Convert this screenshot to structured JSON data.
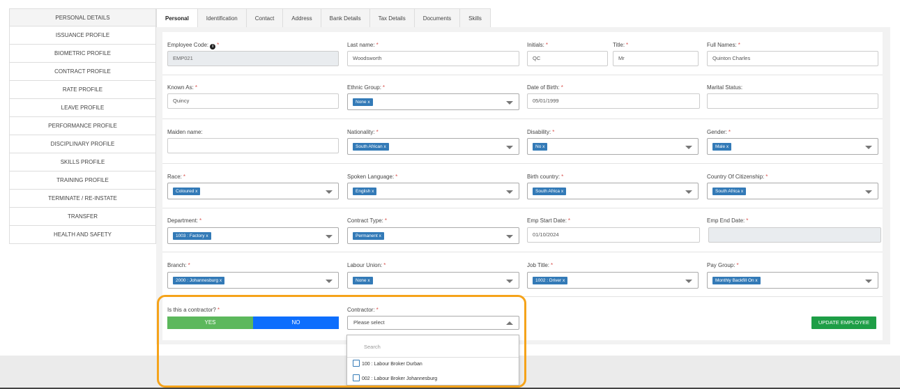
{
  "sidebar": {
    "items": [
      {
        "label": "PERSONAL DETAILS"
      },
      {
        "label": "ISSUANCE PROFILE"
      },
      {
        "label": "BIOMETRIC PROFILE"
      },
      {
        "label": "CONTRACT PROFILE"
      },
      {
        "label": "RATE PROFILE"
      },
      {
        "label": "LEAVE PROFILE"
      },
      {
        "label": "PERFORMANCE PROFILE"
      },
      {
        "label": "DISCIPLINARY PROFILE"
      },
      {
        "label": "SKILLS PROFILE"
      },
      {
        "label": "TRAINING PROFILE"
      },
      {
        "label": "TERMINATE / RE-INSTATE"
      },
      {
        "label": "TRANSFER"
      },
      {
        "label": "HEALTH AND SAFETY"
      }
    ]
  },
  "tabs": [
    {
      "label": "Personal",
      "active": true
    },
    {
      "label": "Identification"
    },
    {
      "label": "Contact"
    },
    {
      "label": "Address"
    },
    {
      "label": "Bank Details"
    },
    {
      "label": "Tax Details"
    },
    {
      "label": "Documents"
    },
    {
      "label": "Skills"
    }
  ],
  "form": {
    "employee_code": {
      "label": "Employee Code:",
      "value": "EMP021",
      "info_icon": "info-icon"
    },
    "last_name": {
      "label": "Last name:",
      "value": "Woodsworth"
    },
    "initials": {
      "label": "Initials:",
      "value": "QC"
    },
    "title": {
      "label": "Title:",
      "value": "Mr"
    },
    "full_names": {
      "label": "Full Names:",
      "value": "Quinton Charles"
    },
    "known_as": {
      "label": "Known As:",
      "value": "Quincy"
    },
    "ethnic_group": {
      "label": "Ethnic Group:",
      "value": "None x"
    },
    "date_of_birth": {
      "label": "Date of Birth:",
      "value": "05/01/1999"
    },
    "marital_status": {
      "label": "Marital Status:",
      "value": ""
    },
    "maiden_name": {
      "label": "Maiden name:",
      "value": ""
    },
    "nationality": {
      "label": "Nationality:",
      "value": "South African x"
    },
    "disability": {
      "label": "Disability:",
      "value": "No x"
    },
    "gender": {
      "label": "Gender:",
      "value": "Male x"
    },
    "race": {
      "label": "Race:",
      "value": "Coloured x"
    },
    "spoken_language": {
      "label": "Spoken Language:",
      "value": "English x"
    },
    "birth_country": {
      "label": "Birth country:",
      "value": "South Africa x"
    },
    "citizenship": {
      "label": "Country Of Citizenship:",
      "value": "South Africa x"
    },
    "department": {
      "label": "Department:",
      "value": "1003 : Factory x"
    },
    "contract_type": {
      "label": "Contract Type:",
      "value": "Permanent x"
    },
    "emp_start_date": {
      "label": "Emp Start Date:",
      "value": "01/10/2024"
    },
    "emp_end_date": {
      "label": "Emp End Date:",
      "value": ""
    },
    "branch": {
      "label": "Branch:",
      "value": "2000 : Johannesburg x"
    },
    "labour_union": {
      "label": "Labour Union:",
      "value": "None x"
    },
    "job_title": {
      "label": "Job Title:",
      "value": "1002 : Driver x"
    },
    "pay_group": {
      "label": "Pay Group:",
      "value": "Monthly Backfill On x"
    },
    "is_contractor": {
      "label": "Is this a contractor?",
      "yes": "YES",
      "no": "NO"
    },
    "contractor": {
      "label": "Contractor:",
      "placeholder": "Please select",
      "search_placeholder": "Search",
      "options": [
        {
          "label": "100 : Labour Broker Durban"
        },
        {
          "label": "002 : Labour Broker Johannesburg"
        }
      ]
    },
    "required_mark": "*",
    "update_button": "UPDATE EMPLOYEE"
  },
  "colors": {
    "chip": "#337ab7",
    "yes": "#5cb85c",
    "no": "#0d6efd",
    "update": "#1e9e46",
    "highlight": "#f5a31a"
  }
}
